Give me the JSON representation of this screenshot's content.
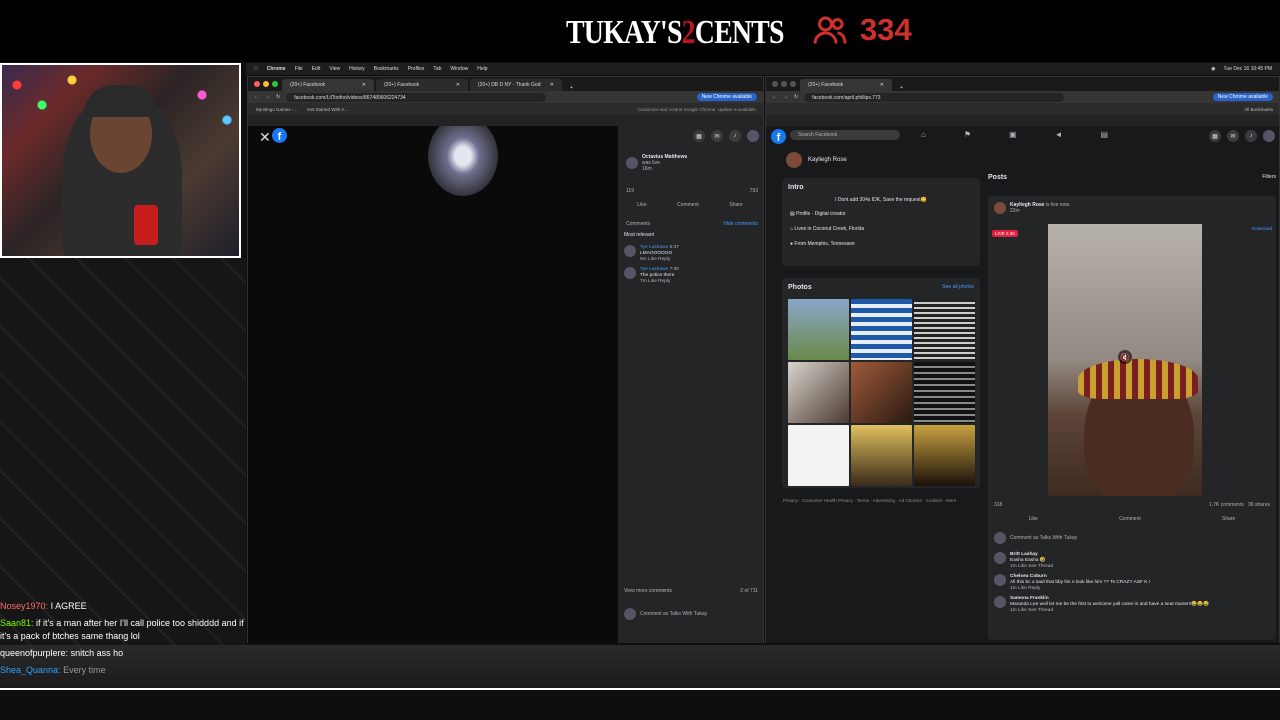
{
  "stream": {
    "brand_main": "TUKAY'S",
    "brand_two": "2",
    "brand_end": "CENTS",
    "viewer_count": "334"
  },
  "chat": [
    {
      "user": "Nosey1970:",
      "message": "I AGREE"
    },
    {
      "user": "Saan81:",
      "message": "if it's a man after her I'll call police too shidddd and if it's a pack of btches same thang lol"
    },
    {
      "user": "queenofpurplere:",
      "message": "snitch ass ho"
    },
    {
      "user": "Shea_Quanna:",
      "message": "Every time"
    }
  ],
  "mac_menubar": {
    "items": [
      "Chrome",
      "File",
      "Edit",
      "View",
      "History",
      "Bookmarks",
      "Profiles",
      "Tab",
      "Window",
      "Help"
    ],
    "clock": "Tue Dec 16 10:45 PM"
  },
  "left_window": {
    "tabs": [
      "(20+) Facebook",
      "(20+) Facebook",
      "(20+) DB D NY - Thank God"
    ],
    "url": "facebook.com/LilToofoo/videos/867480606224734",
    "update_label": "New Chrome available",
    "update_tooltip": "Customize and control Google Chrome. Update is available.",
    "bookmarks": [
      "My Bingo Games -...",
      "Get Started With A..."
    ],
    "poster": {
      "name": "Octavius Matthews",
      "status": "was live.",
      "time": "16m",
      "reaction_count": "119",
      "comment_count": "793"
    },
    "actions": {
      "like": "Like",
      "comment": "Comment",
      "share": "Share"
    },
    "comments_header": "Comments",
    "hide_comments": "Hide comments",
    "sort": "Most relevant",
    "comments": [
      {
        "name": "Tye Lashawn",
        "time": "5:37",
        "text": "LMAOOOOOO",
        "meta": "8m  Like  Reply"
      },
      {
        "name": "Tye Lashawn",
        "time": "7:30",
        "text": "The police there",
        "meta": "7m  Like  Reply"
      }
    ],
    "view_more": "View more comments",
    "count": "2 of 711",
    "comment_placeholder": "Comment as Talks With Tukay"
  },
  "right_window": {
    "tab": "(20+) Facebook",
    "url": "facebook.com/april.phillips.773",
    "update_label": "New Chrome available",
    "bookmarks_right": "All Bookmarks",
    "search_placeholder": "Search Facebook",
    "profile_name": "Kayliegh Rose",
    "intro": {
      "title": "Intro",
      "bio": "I Dont add 304s IDK, Save the request😊",
      "items": [
        "Profile · Digital creator",
        "Lives in Coconut Creek, Florida",
        "From Memphis, Tennessee"
      ]
    },
    "photos": {
      "title": "Photos",
      "see_all": "See all photos"
    },
    "footer": "Privacy · Consumer Health Privacy · Terms · Advertising · Ad Choices · Cookies · More",
    "posts": {
      "title": "Posts",
      "filters": "Filters",
      "author": "Kayliegh Rose",
      "status": "is live now.",
      "time": "22m",
      "live": "LIVE",
      "viewers": "2.2K",
      "download": "Download",
      "reactions": "318",
      "comments": "1.7K comments",
      "shares": "36 shares",
      "like": "Like",
      "comment": "Comment",
      "share": "Share",
      "comment_placeholder": "Comment as Talks With Tukay",
      "comments_list": [
        {
          "name": "Britt Lashay",
          "text": "Easha Easha 🤣",
          "meta": "1m  Like  See Thread"
        },
        {
          "name": "Chelsea Coburn",
          "text": "All this bc u said that bby his n look like him ?? Ts CRAZY ASF K !",
          "meta": "1m  Like  Reply"
        },
        {
          "name": "Samona Franklin",
          "text": "Maranda Lee well let me be the first to welcome yall come in and have a seat maner!!😂😂😂",
          "meta": "1m  Like  See Thread"
        }
      ]
    }
  }
}
